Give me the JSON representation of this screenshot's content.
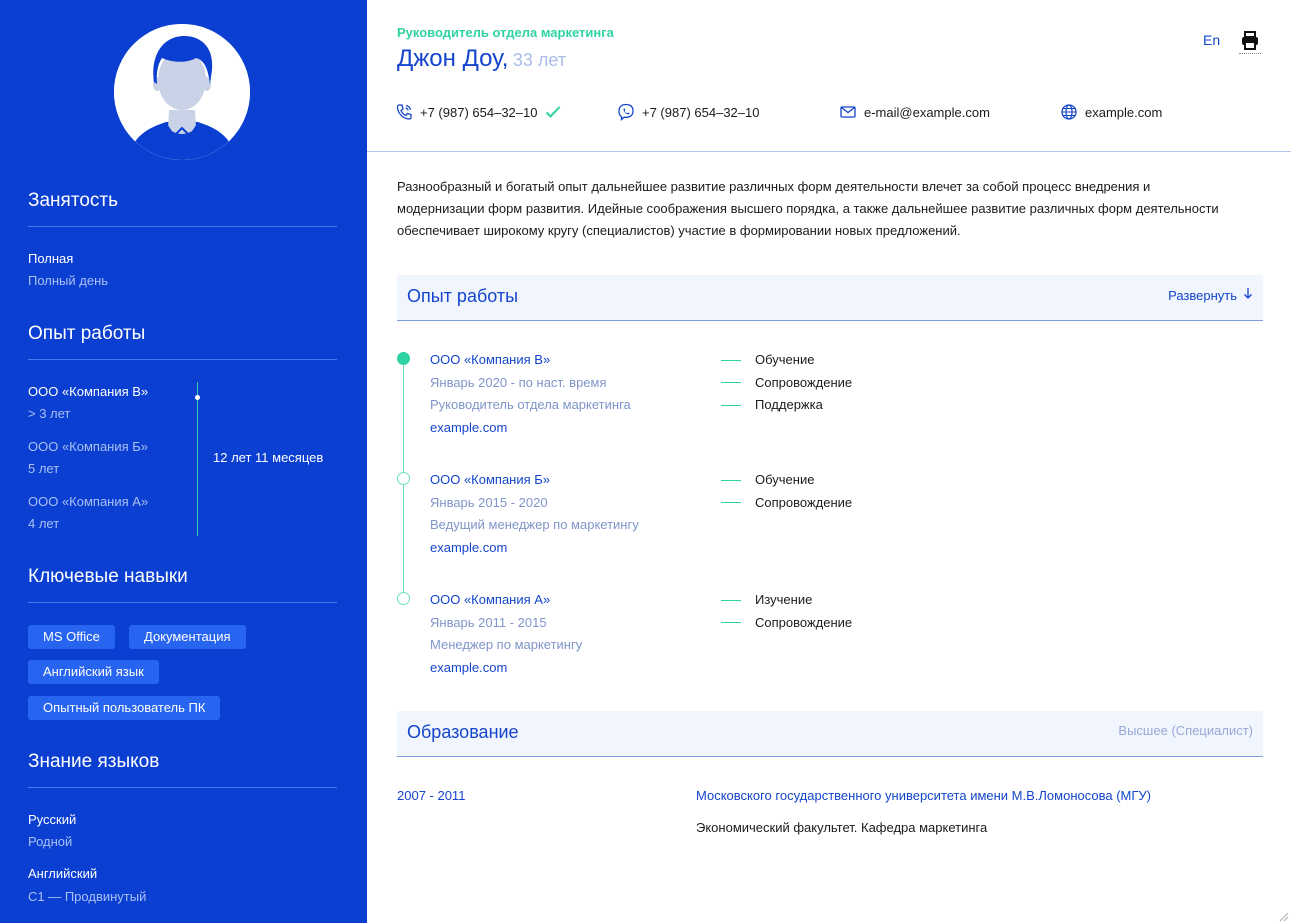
{
  "sidebar": {
    "employment": {
      "title": "Занятость",
      "type": "Полная",
      "schedule": "Полный день"
    },
    "experience": {
      "title": "Опыт работы",
      "items": [
        {
          "company": "ООО «Компания В»",
          "duration": "> 3 лет"
        },
        {
          "company": "ООО «Компания Б»",
          "duration": "5 лет"
        },
        {
          "company": "ООО «Компания А»",
          "duration": "4 лет"
        }
      ],
      "total": "12 лет 11 месяцев"
    },
    "skills": {
      "title": "Ключевые навыки",
      "items": [
        "MS Office",
        "Документация",
        "Английский язык",
        "Опытный пользователь ПК"
      ]
    },
    "languages": {
      "title": "Знание языков",
      "items": [
        {
          "name": "Русский",
          "level": "Родной"
        },
        {
          "name": "Английский",
          "level": "C1 — Продвинутый"
        }
      ]
    }
  },
  "header": {
    "role": "Руководитель отдела маркетинга",
    "name": "Джон Доу,",
    "age": "33 лет",
    "lang_button": "En",
    "contacts": {
      "phone": "+7 (987) 654–32–10",
      "viber": "+7 (987) 654–32–10",
      "email": "e-mail@example.com",
      "site": "example.com"
    }
  },
  "summary": "Разнообразный и богатый опыт дальнейшее развитие различных форм деятельности влечет за собой процесс внедрения и модернизации форм развития. Идейные соображения высшего порядка, а также дальнейшее развитие различных форм деятельности обеспечивает широкому кругу (специалистов) участие в формировании новых предложений.",
  "experience": {
    "title": "Опыт работы",
    "expand_label": "Развернуть",
    "jobs": [
      {
        "company": "ООО «Компания В»",
        "period": "Январь 2020 - по наст. время",
        "position": "Руководитель отдела маркетинга",
        "site": "example.com",
        "duties": [
          "Обучение",
          "Сопровождение",
          "Поддержка"
        ]
      },
      {
        "company": "ООО «Компания Б»",
        "period": "Январь 2015 - 2020",
        "position": "Ведущий менеджер по маркетингу",
        "site": "example.com",
        "duties": [
          "Обучение",
          "Сопровождение"
        ]
      },
      {
        "company": "ООО «Компания А»",
        "period": "Январь 2011 - 2015",
        "position": "Менеджер по маркетингу",
        "site": "example.com",
        "duties": [
          "Изучение",
          "Сопровождение"
        ]
      }
    ]
  },
  "education": {
    "title": "Образование",
    "level": "Высшее (Специалист)",
    "years": "2007 - 2011",
    "university": "Московского государственного университета имени М.В.Ломоносова (МГУ)",
    "faculty": "Экономический факультет. Кафедра маркетинга"
  },
  "colors": {
    "sidebar": "#0b3fd1",
    "accent_green": "#2fd3a4",
    "link_blue": "#1445cc",
    "chip": "#2764f0"
  },
  "icons": [
    "avatar-icon",
    "phone-icon",
    "check-icon",
    "viber-icon",
    "mail-icon",
    "globe-icon",
    "printer-icon",
    "arrow-down-icon"
  ]
}
